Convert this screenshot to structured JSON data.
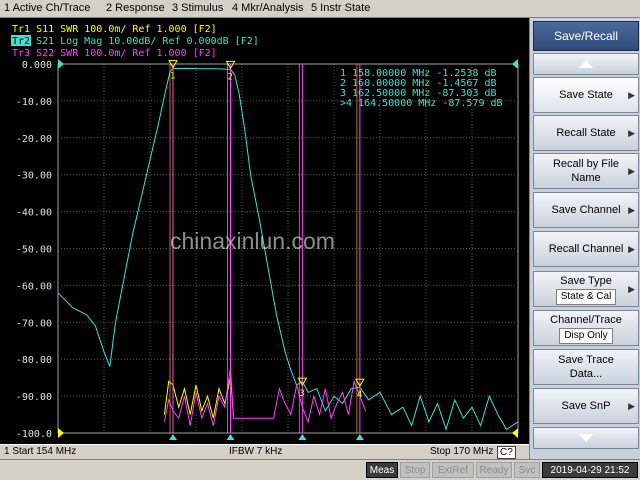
{
  "menu": {
    "items": [
      {
        "label": "1 Active Ch/Trace"
      },
      {
        "label": "2 Response"
      },
      {
        "label": "3 Stimulus"
      },
      {
        "label": "4 Mkr/Analysis"
      },
      {
        "label": "5 Instr State"
      }
    ]
  },
  "traces": [
    {
      "label": "Tr1  S11  SWR 100.0m/ Ref 1.000  [F2]",
      "color": "#ffff00"
    },
    {
      "label": "S21  Log Mag 10.00dB/ Ref 0.000dB  [F2]",
      "tag": "Tr2",
      "color": "#40e0d0"
    },
    {
      "label": "Tr3  S22  SWR 100.0m/ Ref 1.000  [F2]",
      "color": "#ff40ff"
    }
  ],
  "y_axis": {
    "labels": [
      "0.000",
      "-10.00",
      "-20.00",
      "-30.00",
      "-40.00",
      "-50.00",
      "-60.00",
      "-70.00",
      "-80.00",
      "-90.00",
      "-100.0"
    ]
  },
  "markers": [
    {
      "id": "1",
      "freq": "158.00000 MHz",
      "value": "-1.2538 dB",
      "prefix": ""
    },
    {
      "id": "2",
      "freq": "160.00000 MHz",
      "value": "-1.4567 dB",
      "prefix": ""
    },
    {
      "id": "3",
      "freq": "162.50000 MHz",
      "value": "-87.303 dB",
      "prefix": ""
    },
    {
      "id": "4",
      "freq": "164.50000 MHz",
      "value": "-87.579 dB",
      "prefix": ">"
    }
  ],
  "chart_data": {
    "type": "line",
    "title": "",
    "xlabel": "",
    "ylabel": "",
    "xlim": [
      154,
      170
    ],
    "ylim": [
      -100,
      0
    ],
    "grid": true,
    "series": [
      {
        "name": "S21 Log Mag",
        "color": "#40e0d0",
        "x": [
          154.0,
          154.5,
          155.0,
          155.3,
          155.6,
          155.8,
          156.0,
          156.3,
          156.6,
          156.9,
          157.2,
          157.5,
          157.75,
          157.9,
          158.0,
          158.5,
          159.0,
          159.5,
          160.0,
          160.15,
          160.3,
          160.5,
          160.7,
          161.0,
          161.3,
          161.6,
          161.9,
          162.1,
          162.3,
          162.5,
          162.7,
          163.0,
          163.3,
          163.6,
          163.9,
          164.2,
          164.5,
          164.8,
          165.2,
          165.6,
          166.0,
          166.3,
          166.6,
          166.9,
          167.2,
          167.5,
          167.8,
          168.1,
          168.4,
          168.7,
          169.0,
          169.3,
          169.6,
          170.0
        ],
        "y": [
          -62,
          -66,
          -68,
          -71,
          -78,
          -82,
          -70,
          -58,
          -46,
          -36,
          -26,
          -16,
          -7,
          -2,
          -1.25,
          -1.2,
          -1.3,
          -1.3,
          -1.46,
          -3,
          -8,
          -18,
          -30,
          -42,
          -55,
          -68,
          -78,
          -83,
          -87,
          -86,
          -89,
          -88,
          -94,
          -90,
          -92,
          -88,
          -87.6,
          -91,
          -89,
          -95,
          -93,
          -98,
          -90,
          -97,
          -92,
          -99,
          -91,
          -96,
          -93,
          -98,
          -90,
          -95,
          -99,
          -97
        ]
      },
      {
        "name": "S11 SWR",
        "color": "#ffff00",
        "x": [
          157.7,
          157.85,
          158.0,
          158.2,
          158.4,
          158.6,
          158.8,
          159.0,
          159.2,
          159.4,
          159.6,
          159.8,
          160.0,
          160.1
        ],
        "y": [
          -95,
          -86,
          -87,
          -93,
          -88,
          -95,
          -87,
          -94,
          -90,
          -96,
          -88,
          -92,
          -85,
          -95
        ]
      },
      {
        "name": "S22 SWR",
        "color": "#ff40ff",
        "x": [
          157.7,
          157.85,
          158.0,
          158.2,
          158.4,
          158.6,
          158.8,
          159.0,
          159.2,
          159.4,
          159.6,
          159.8,
          160.0,
          160.1,
          161.5,
          161.7,
          161.9,
          162.1,
          162.3,
          162.5,
          162.7,
          162.9,
          163.1,
          163.3,
          163.5,
          163.7,
          163.9,
          164.1,
          164.3,
          164.5,
          164.7
        ],
        "y": [
          -97,
          -91,
          -94,
          -96,
          -90,
          -98,
          -89,
          -96,
          -92,
          -98,
          -90,
          -93,
          -82,
          -96,
          -96,
          -88,
          -92,
          -95,
          -87,
          -93,
          -97,
          -90,
          -95,
          -88,
          -96,
          -92,
          -89,
          -95,
          -86,
          -90,
          -94
        ]
      }
    ],
    "marker_points": [
      {
        "id": "1",
        "x": 158.0,
        "y": -1.25
      },
      {
        "id": "2",
        "x": 160.0,
        "y": -1.46
      },
      {
        "id": "3",
        "x": 162.5,
        "y": -87.3
      },
      {
        "id": "4",
        "x": 164.5,
        "y": -87.58
      }
    ]
  },
  "status": {
    "start": "1  Start 154 MHz",
    "ifbw": "IFBW 7 kHz",
    "stop": "Stop 170 MHz",
    "cal": "C?"
  },
  "indicators": [
    {
      "label": "Meas",
      "on": true
    },
    {
      "label": "Stop",
      "on": false
    },
    {
      "label": "ExtRef",
      "on": false
    },
    {
      "label": "Ready",
      "on": false
    },
    {
      "label": "Svc",
      "on": false
    }
  ],
  "datetime": "2019-04-29 21:52",
  "watermark": "chinaxinlun.com",
  "softkeys": {
    "title": "Save/Recall",
    "items": [
      {
        "label": "Save State",
        "arrow": true,
        "active": true
      },
      {
        "label": "Recall State",
        "arrow": true
      },
      {
        "label": "Recall by File Name",
        "arrow": true
      },
      {
        "label": "Save Channel",
        "arrow": true
      },
      {
        "label": "Recall Channel",
        "arrow": true
      },
      {
        "label": "Save Type",
        "sub": "State & Cal",
        "arrow": true
      },
      {
        "label": "Channel/Trace",
        "sub": "Disp Only"
      },
      {
        "label": "Save Trace Data..."
      },
      {
        "label": "Save SnP",
        "arrow": true
      }
    ]
  }
}
